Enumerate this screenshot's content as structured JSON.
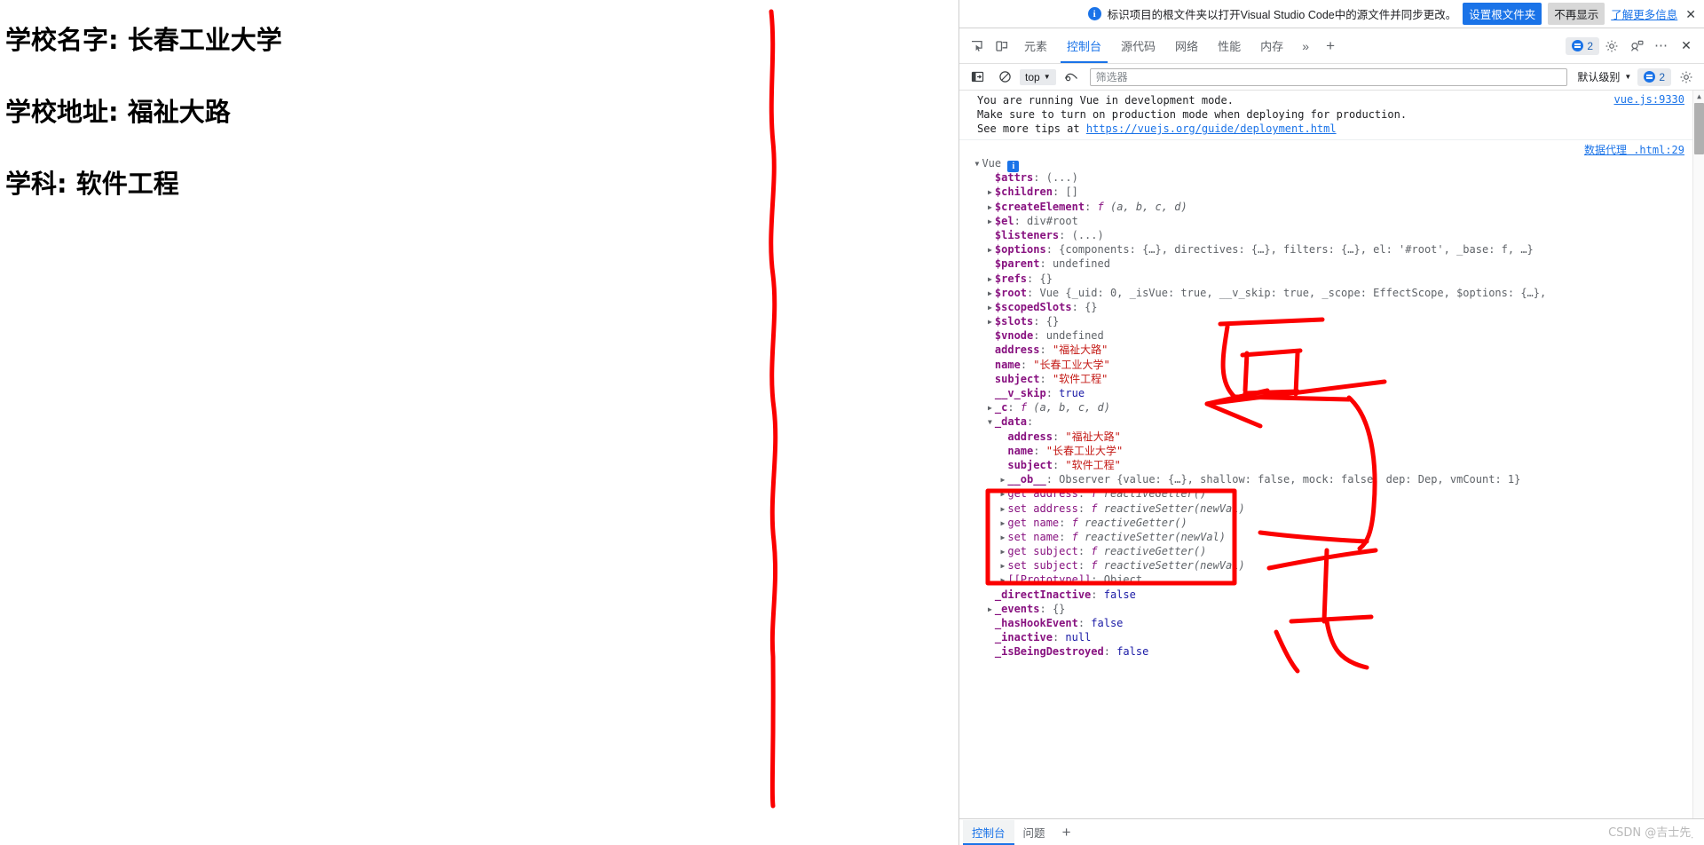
{
  "page": {
    "lines": [
      "学校名字: 长春工业大学",
      "学校地址: 福祉大路",
      "学科: 软件工程"
    ]
  },
  "devtools": {
    "infobar": {
      "icon": "info-circle-icon",
      "message": "标识项目的根文件夹以打开Visual Studio Code中的源文件并同步更改。",
      "primary_button": "设置根文件夹",
      "secondary_button": "不再显示",
      "learn_more": "了解更多信息",
      "close_icon": "close-icon"
    },
    "tabs": {
      "inspect_icon": "inspect-element-icon",
      "device_icon": "device-toolbar-icon",
      "items": [
        {
          "label": "元素",
          "active": false
        },
        {
          "label": "控制台",
          "active": true
        },
        {
          "label": "源代码",
          "active": false
        },
        {
          "label": "网络",
          "active": false
        },
        {
          "label": "性能",
          "active": false
        },
        {
          "label": "内存",
          "active": false
        }
      ],
      "more_icon": "chevrons-right-icon",
      "add_icon": "plus-icon",
      "issues_count": "2",
      "settings_icon": "gear-icon",
      "customize_icon": "dock-side-icon",
      "menu_icon": "more-options-icon",
      "close_icon": "close-icon"
    },
    "console_toolbar": {
      "sidebar_icon": "console-sidebar-icon",
      "clear_icon": "clear-console-icon",
      "context": "top",
      "eye_icon": "live-expression-icon",
      "filter_placeholder": "筛选器",
      "filter_value": "",
      "level": "默认级别",
      "issues_count": "2",
      "settings_icon": "gear-icon"
    },
    "messages": {
      "vue_warning": {
        "lines": [
          "You are running Vue in development mode.",
          "Make sure to turn on production mode when deploying for production.",
          "See more tips at "
        ],
        "link_text": "https://vuejs.org/guide/deployment.html",
        "source": "vue.js:9330"
      },
      "object_log": {
        "source": "数据代理 .html:29",
        "root_label": "Vue",
        "root_badge": "i",
        "rows": [
          {
            "indent": 1,
            "arrow": "down",
            "key": "Vue",
            "keystyle": "plain",
            "sep": "",
            "value": "",
            "valstyle": "obj",
            "badge": "i"
          },
          {
            "indent": 2,
            "arrow": "none",
            "key": "$attrs",
            "keystyle": "name",
            "sep": ": ",
            "value": "(...)",
            "valstyle": "obj"
          },
          {
            "indent": 2,
            "arrow": "right",
            "key": "$children",
            "keystyle": "name",
            "sep": ": ",
            "value": "[]",
            "valstyle": "obj"
          },
          {
            "indent": 2,
            "arrow": "right",
            "key": "$createElement",
            "keystyle": "name",
            "sep": ": ",
            "value": "f (a, b, c, d)",
            "valstyle": "fn"
          },
          {
            "indent": 2,
            "arrow": "right",
            "key": "$el",
            "keystyle": "name",
            "sep": ": ",
            "value": "div#root",
            "valstyle": "elem"
          },
          {
            "indent": 2,
            "arrow": "none",
            "key": "$listeners",
            "keystyle": "name",
            "sep": ": ",
            "value": "(...)",
            "valstyle": "obj"
          },
          {
            "indent": 2,
            "arrow": "right",
            "key": "$options",
            "keystyle": "name",
            "sep": ": ",
            "value": "{components: {…}, directives: {…}, filters: {…}, el: '#root', _base: f, …}",
            "valstyle": "obj"
          },
          {
            "indent": 2,
            "arrow": "none",
            "key": "$parent",
            "keystyle": "name",
            "sep": ": ",
            "value": "undefined",
            "valstyle": "undef"
          },
          {
            "indent": 2,
            "arrow": "right",
            "key": "$refs",
            "keystyle": "name",
            "sep": ": ",
            "value": "{}",
            "valstyle": "obj"
          },
          {
            "indent": 2,
            "arrow": "right",
            "key": "$root",
            "keystyle": "name",
            "sep": ": ",
            "value": "Vue {_uid: 0, _isVue: true, __v_skip: true, _scope: EffectScope, $options: {…},",
            "valstyle": "obj"
          },
          {
            "indent": 2,
            "arrow": "right",
            "key": "$scopedSlots",
            "keystyle": "name",
            "sep": ": ",
            "value": "{}",
            "valstyle": "obj"
          },
          {
            "indent": 2,
            "arrow": "right",
            "key": "$slots",
            "keystyle": "name",
            "sep": ": ",
            "value": "{}",
            "valstyle": "obj"
          },
          {
            "indent": 2,
            "arrow": "none",
            "key": "$vnode",
            "keystyle": "name",
            "sep": ": ",
            "value": "undefined",
            "valstyle": "undef"
          },
          {
            "indent": 2,
            "arrow": "none",
            "key": "address",
            "keystyle": "name",
            "sep": ": ",
            "value": "\"福祉大路\"",
            "valstyle": "str"
          },
          {
            "indent": 2,
            "arrow": "none",
            "key": "name",
            "keystyle": "name",
            "sep": ": ",
            "value": "\"长春工业大学\"",
            "valstyle": "str"
          },
          {
            "indent": 2,
            "arrow": "none",
            "key": "subject",
            "keystyle": "name",
            "sep": ": ",
            "value": "\"软件工程\"",
            "valstyle": "str"
          },
          {
            "indent": 2,
            "arrow": "none",
            "key": "__v_skip",
            "keystyle": "name",
            "sep": ": ",
            "value": "true",
            "valstyle": "bool"
          },
          {
            "indent": 2,
            "arrow": "right",
            "key": "_c",
            "keystyle": "name",
            "sep": ": ",
            "value": "f (a, b, c, d)",
            "valstyle": "fn"
          },
          {
            "indent": 2,
            "arrow": "down",
            "key": "_data",
            "keystyle": "name",
            "sep": ":",
            "value": "",
            "valstyle": "obj"
          },
          {
            "indent": 3,
            "arrow": "none",
            "key": "address",
            "keystyle": "name",
            "sep": ": ",
            "value": "\"福祉大路\"",
            "valstyle": "str"
          },
          {
            "indent": 3,
            "arrow": "none",
            "key": "name",
            "keystyle": "name",
            "sep": ": ",
            "value": "\"长春工业大学\"",
            "valstyle": "str"
          },
          {
            "indent": 3,
            "arrow": "none",
            "key": "subject",
            "keystyle": "name",
            "sep": ": ",
            "value": "\"软件工程\"",
            "valstyle": "str"
          },
          {
            "indent": 3,
            "arrow": "right",
            "key": "__ob__",
            "keystyle": "name",
            "sep": ": ",
            "value": "Observer {value: {…}, shallow: false, mock: false, dep: Dep, vmCount: 1}",
            "valstyle": "obj"
          },
          {
            "indent": 3,
            "arrow": "right",
            "key": "get address",
            "keystyle": "accessor",
            "sep": ": ",
            "value": "f reactiveGetter()",
            "valstyle": "fn"
          },
          {
            "indent": 3,
            "arrow": "right",
            "key": "set address",
            "keystyle": "accessor",
            "sep": ": ",
            "value": "f reactiveSetter(newVal)",
            "valstyle": "fn"
          },
          {
            "indent": 3,
            "arrow": "right",
            "key": "get name",
            "keystyle": "accessor",
            "sep": ": ",
            "value": "f reactiveGetter()",
            "valstyle": "fn"
          },
          {
            "indent": 3,
            "arrow": "right",
            "key": "set name",
            "keystyle": "accessor",
            "sep": ": ",
            "value": "f reactiveSetter(newVal)",
            "valstyle": "fn"
          },
          {
            "indent": 3,
            "arrow": "right",
            "key": "get subject",
            "keystyle": "accessor",
            "sep": ": ",
            "value": "f reactiveGetter()",
            "valstyle": "fn"
          },
          {
            "indent": 3,
            "arrow": "right",
            "key": "set subject",
            "keystyle": "accessor",
            "sep": ": ",
            "value": "f reactiveSetter(newVal)",
            "valstyle": "fn"
          },
          {
            "indent": 3,
            "arrow": "right",
            "key": "[[Prototype]]",
            "keystyle": "proto",
            "sep": ": ",
            "value": "Object",
            "valstyle": "obj"
          },
          {
            "indent": 2,
            "arrow": "none",
            "key": "_directInactive",
            "keystyle": "name",
            "sep": ": ",
            "value": "false",
            "valstyle": "bool"
          },
          {
            "indent": 2,
            "arrow": "right",
            "key": "_events",
            "keystyle": "name",
            "sep": ": ",
            "value": "{}",
            "valstyle": "obj"
          },
          {
            "indent": 2,
            "arrow": "none",
            "key": "_hasHookEvent",
            "keystyle": "name",
            "sep": ": ",
            "value": "false",
            "valstyle": "bool"
          },
          {
            "indent": 2,
            "arrow": "none",
            "key": "_inactive",
            "keystyle": "name",
            "sep": ": ",
            "value": "null",
            "valstyle": "null"
          },
          {
            "indent": 2,
            "arrow": "none",
            "key": "_isBeingDestroyed",
            "keystyle": "name",
            "sep": ": ",
            "value": "false",
            "valstyle": "bool"
          }
        ]
      }
    },
    "drawer": {
      "tabs": [
        {
          "label": "控制台",
          "active": true
        },
        {
          "label": "问题",
          "active": false
        }
      ],
      "add_icon": "plus-icon"
    },
    "watermark": "CSDN @吉士先຺"
  },
  "colors": {
    "accent": "#1a73e8",
    "annotation": "#fb0000",
    "string": "#c41a16",
    "key": "#881280",
    "number": "#1a1aa6"
  },
  "annotations": {
    "present": true,
    "description": "red hand-drawn marks: long vertical squiggle separating page and devtools, arrow pointing at $root, characters, and a box around _data"
  }
}
